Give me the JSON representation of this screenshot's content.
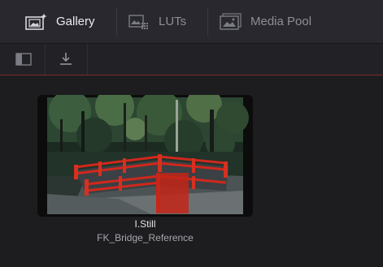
{
  "tabs": [
    {
      "label": "Gallery",
      "icon": "gallery-icon",
      "active": true
    },
    {
      "label": "LUTs",
      "icon": "luts-icon",
      "active": false
    },
    {
      "label": "Media Pool",
      "icon": "media-pool-icon",
      "active": false
    }
  ],
  "toolbar": {
    "panel_icon": "sidebar-toggle-icon",
    "import_icon": "import-icon"
  },
  "stills": [
    {
      "label": "I.Still",
      "name": "FK_Bridge_Reference"
    }
  ],
  "colors": {
    "background": "#1c1c1f",
    "tabbar": "#28282e",
    "active_text": "#ececf0",
    "inactive_text": "#8d8e95",
    "accent_line": "#7a2a2a",
    "bridge_red": "#d0281c"
  }
}
